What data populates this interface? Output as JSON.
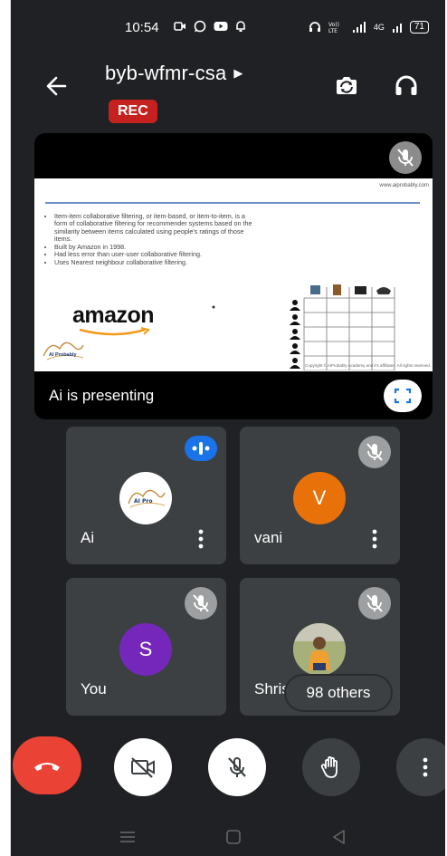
{
  "status_bar": {
    "time": "10:54",
    "battery": "71",
    "network": "4G"
  },
  "header": {
    "meeting_code": "byb-wfmr-csa",
    "rec_label": "REC",
    "icons": [
      "back-arrow-icon",
      "switch-camera-icon",
      "headphones-icon"
    ]
  },
  "presentation": {
    "presenter_label": "Ai is presenting",
    "slide": {
      "url": "www.aiprobably.com",
      "bullets": [
        "Item-item collaborative filtering, or item-based, or item-to-item, is a form of collaborative filtering for recommender systems based on the similarity between items calculated using people's ratings of those items.",
        "Built by Amazon in 1998.",
        "Had less error than user-user collaborative filtering.",
        "Uses Nearest neighbour collaborative filtering."
      ],
      "brand": "amazon",
      "logo_text": "AI Probably",
      "copyright": "Copyright © AiProbably Academy and it's affiliates. All rights reserved."
    }
  },
  "participants": [
    {
      "name": "Ai",
      "avatar": "",
      "speaking": true,
      "muted": false,
      "color": "#ffffff"
    },
    {
      "name": "vani",
      "avatar": "V",
      "speaking": false,
      "muted": true,
      "color": "#e8710a"
    },
    {
      "name": "You",
      "avatar": "S",
      "speaking": false,
      "muted": true,
      "color": "#7627bb"
    },
    {
      "name": "Shris",
      "avatar": "",
      "speaking": false,
      "muted": true,
      "color": ""
    }
  ],
  "others_label": "98 others",
  "controls": {
    "end_call_color": "#ea4335",
    "items": [
      "end-call",
      "camera-off",
      "mic-off",
      "raise-hand",
      "more-options"
    ]
  }
}
